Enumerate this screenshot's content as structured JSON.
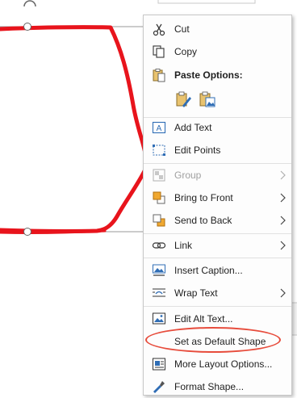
{
  "menu": {
    "cut": "Cut",
    "copy": "Copy",
    "paste_options": "Paste Options:",
    "add_text": "Add Text",
    "edit_points": "Edit Points",
    "group": "Group",
    "bring_to_front": "Bring to Front",
    "send_to_back": "Send to Back",
    "link": "Link",
    "insert_caption": "Insert Caption...",
    "wrap_text": "Wrap Text",
    "edit_alt_text": "Edit Alt Text...",
    "set_default_shape": "Set as Default Shape",
    "more_layout_options": "More Layout Options...",
    "format_shape": "Format Shape..."
  },
  "icons": {
    "cut": "scissors-icon",
    "copy": "copy-icon",
    "paste": "clipboard-icon",
    "add_text": "text-box-icon",
    "edit_points": "edit-points-icon",
    "group": "group-icon",
    "bring_to_front": "bring-to-front-icon",
    "send_to_back": "send-to-back-icon",
    "link": "link-icon",
    "insert_caption": "caption-icon",
    "wrap_text": "wrap-text-icon",
    "edit_alt_text": "alt-text-icon",
    "more_layout_options": "layout-options-icon",
    "format_shape": "format-shape-icon"
  },
  "colors": {
    "shape_stroke": "#e8141c",
    "highlight": "#e74c3c",
    "icon_blue": "#2f6db5"
  }
}
